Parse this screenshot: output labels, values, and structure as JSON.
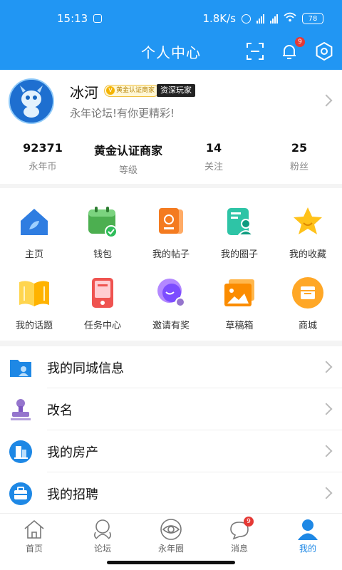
{
  "status_bar": {
    "time": "15:13",
    "speed": "1.8K/s",
    "battery": "78"
  },
  "header": {
    "title": "个人中心",
    "bell_badge": "9"
  },
  "profile": {
    "username": "冰河",
    "badge_gold": "黄金认证商家",
    "badge_dark": "资深玩家",
    "motto": "永年论坛!有你更精彩!"
  },
  "stats": [
    {
      "value": "92371",
      "label": "永年币"
    },
    {
      "value": "黄金认证商家",
      "label": "等级"
    },
    {
      "value": "14",
      "label": "关注"
    },
    {
      "value": "25",
      "label": "粉丝"
    }
  ],
  "grid": [
    {
      "label": "主页",
      "icon": "home-icon"
    },
    {
      "label": "钱包",
      "icon": "wallet-icon"
    },
    {
      "label": "我的帖子",
      "icon": "posts-icon"
    },
    {
      "label": "我的圈子",
      "icon": "circle-icon"
    },
    {
      "label": "我的收藏",
      "icon": "star-icon"
    },
    {
      "label": "我的话题",
      "icon": "topic-book-icon"
    },
    {
      "label": "任务中心",
      "icon": "task-icon"
    },
    {
      "label": "邀请有奖",
      "icon": "invite-icon"
    },
    {
      "label": "草稿箱",
      "icon": "drafts-icon"
    },
    {
      "label": "商城",
      "icon": "mall-icon"
    }
  ],
  "list": [
    {
      "label": "我的同城信息",
      "icon": "folder-user-icon"
    },
    {
      "label": "改名",
      "icon": "stamp-icon"
    },
    {
      "label": "我的房产",
      "icon": "building-icon"
    },
    {
      "label": "我的招聘",
      "icon": "briefcase-icon"
    }
  ],
  "bottom_nav": [
    {
      "label": "首页",
      "icon": "home-outline-icon"
    },
    {
      "label": "论坛",
      "icon": "forum-icon"
    },
    {
      "label": "永年圈",
      "icon": "eye-circle-icon"
    },
    {
      "label": "消息",
      "icon": "message-icon",
      "badge": "9"
    },
    {
      "label": "我的",
      "icon": "user-icon",
      "active": true
    }
  ],
  "colors": {
    "primary": "#2196f3",
    "active_tab": "#1e88e5",
    "badge": "#e53935"
  }
}
